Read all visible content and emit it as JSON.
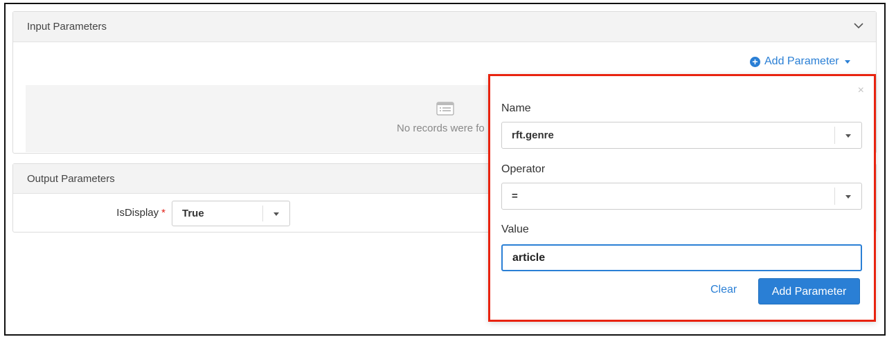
{
  "input_parameters": {
    "title": "Input Parameters",
    "add_parameter_label": "Add Parameter",
    "empty_text": "No records were fo"
  },
  "output_parameters": {
    "title": "Output Parameters",
    "isdisplay_label": "IsDisplay",
    "required_mark": "*",
    "isdisplay_value": "True"
  },
  "popover": {
    "close": "×",
    "name_label": "Name",
    "name_value": "rft.genre",
    "operator_label": "Operator",
    "operator_value": "=",
    "value_label": "Value",
    "value_value": "article",
    "clear_label": "Clear",
    "submit_label": "Add Parameter",
    "highlight_color": "#e8230f"
  },
  "colors": {
    "accent": "#2a7fd5",
    "header_bg": "#f3f3f3"
  }
}
